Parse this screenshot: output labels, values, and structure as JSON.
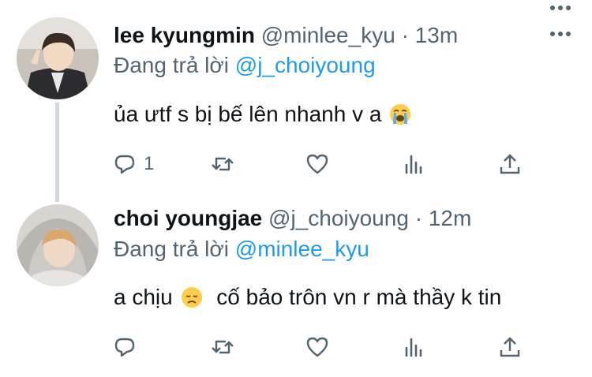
{
  "colors": {
    "text": "#0f1419",
    "secondary": "#536471",
    "accent": "#1d9bf0",
    "thread_line": "#cfd9de"
  },
  "tweets": [
    {
      "name": "lee kyungmin",
      "handle": "@minlee_kyu",
      "dot": "·",
      "time": "13m",
      "reply_prefix": "Đang trả lời",
      "reply_mention": "@j_choiyoung",
      "text": "ủa ưtf s bị bế lên nhanh v a",
      "emoji": "loudly-crying-face",
      "reply_count": "1",
      "icons": [
        "reply-icon",
        "retweet-icon",
        "like-icon",
        "stats-icon",
        "share-icon",
        "more-icon"
      ]
    },
    {
      "name": "choi youngjae",
      "handle": "@j_choiyoung",
      "dot": "·",
      "time": "12m",
      "reply_prefix": "Đang trả lời",
      "reply_mention": "@minlee_kyu",
      "text_before_emoji": "a chịu",
      "emoji": "disappointed-face",
      "text_after_emoji": "cố bảo trôn vn r mà thầy k tin",
      "icons": [
        "reply-icon",
        "retweet-icon",
        "like-icon",
        "stats-icon",
        "share-icon",
        "more-icon"
      ]
    }
  ]
}
